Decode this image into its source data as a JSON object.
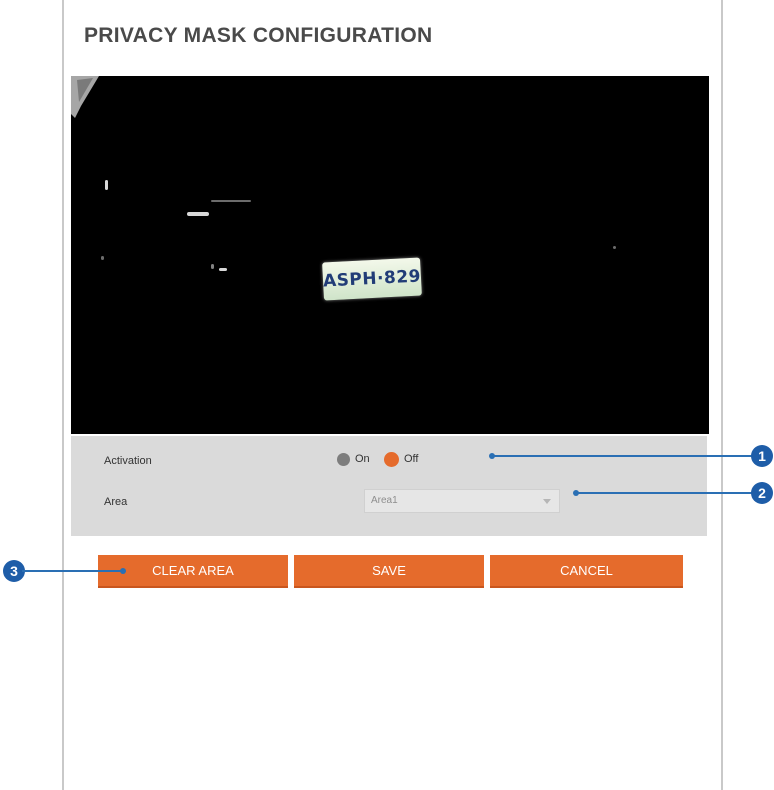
{
  "page": {
    "title": "PRIVACY MASK CONFIGURATION"
  },
  "video": {
    "plate_text": "ASPH·829"
  },
  "activation": {
    "label": "Activation",
    "on_label": "On",
    "off_label": "Off",
    "selected": "Off"
  },
  "area": {
    "label": "Area",
    "value": "Area1"
  },
  "buttons": {
    "clear": "CLEAR AREA",
    "save": "SAVE",
    "cancel": "CANCEL"
  },
  "callouts": [
    "1",
    "2",
    "3"
  ],
  "colors": {
    "accent": "#e56b2c",
    "callout": "#1e5da8",
    "radio_off": "#7d7d7d"
  }
}
